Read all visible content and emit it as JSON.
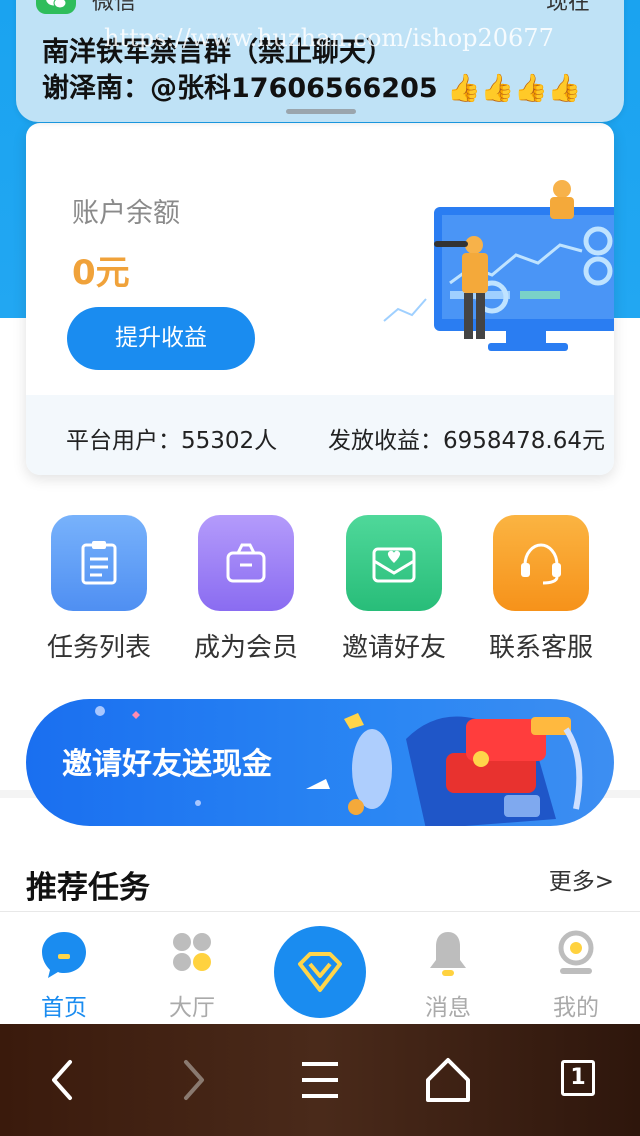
{
  "notification": {
    "app_name": "微信",
    "time": "现在",
    "title": "南洋铁军禁言群（禁止聊天）",
    "body": "谢泽南：@张科17606566205 👍👍👍👍",
    "watermark": "https://www.huzhan.com/ishop20677"
  },
  "account": {
    "balance_label": "账户余额",
    "balance_value": "0元",
    "upgrade_button": "提升收益",
    "platform_users": "平台用户：55302人",
    "payout": "发放收益：6958478.64元"
  },
  "quick_actions": [
    {
      "label": "任务列表",
      "icon": "clipboard-icon",
      "color": "#5b9cf4"
    },
    {
      "label": "成为会员",
      "icon": "bag-icon",
      "color": "#9b7cf5"
    },
    {
      "label": "邀请好友",
      "icon": "envelope-heart-icon",
      "color": "#34c983"
    },
    {
      "label": "联系客服",
      "icon": "headset-icon",
      "color": "#f9a12e"
    }
  ],
  "banner": {
    "text": "邀请好友送现金"
  },
  "recommend": {
    "title": "推荐任务",
    "more": "更多>"
  },
  "tabbar": {
    "items": [
      {
        "label": "首页",
        "icon": "home-chat-icon",
        "active": true
      },
      {
        "label": "大厅",
        "icon": "grid-dots-icon",
        "active": false
      },
      {
        "label": "",
        "icon": "diamond-icon",
        "active": false
      },
      {
        "label": "消息",
        "icon": "bell-icon",
        "active": false
      },
      {
        "label": "我的",
        "icon": "profile-icon",
        "active": false
      }
    ]
  },
  "browser_nav": {
    "tab_count": "1"
  },
  "colors": {
    "primary": "#1a8cf0",
    "balance": "#f0a23a",
    "hero": "#1aa3f0"
  }
}
